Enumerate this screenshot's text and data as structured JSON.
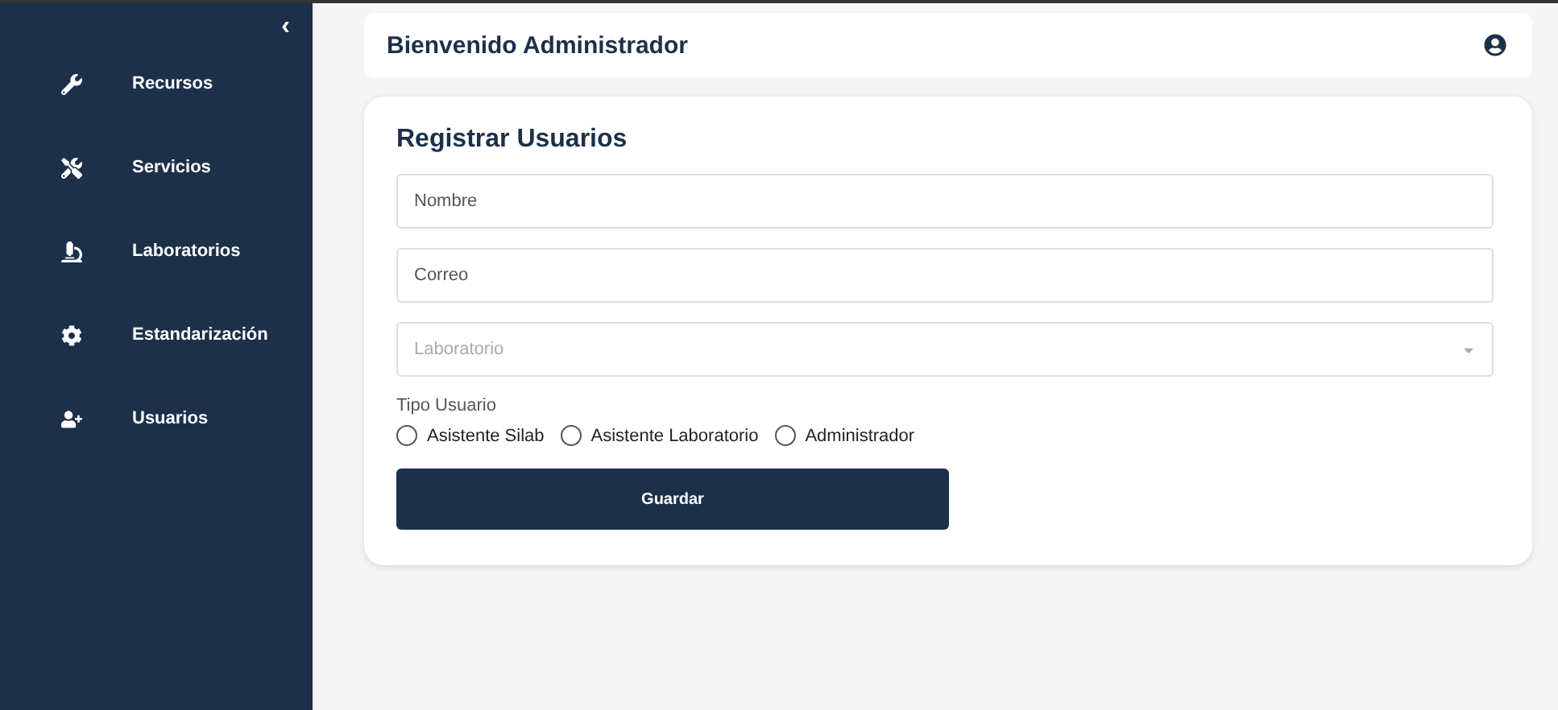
{
  "sidebar": {
    "collapse": "‹",
    "items": [
      {
        "label": "Recursos"
      },
      {
        "label": "Servicios"
      },
      {
        "label": "Laboratorios"
      },
      {
        "label": "Estandarización"
      },
      {
        "label": "Usuarios"
      }
    ]
  },
  "header": {
    "title": "Bienvenido Administrador"
  },
  "form": {
    "title": "Registrar Usuarios",
    "fields": [
      {
        "kind": "text",
        "placeholder": "Nombre"
      },
      {
        "kind": "text",
        "placeholder": "Correo"
      },
      {
        "kind": "select",
        "placeholder": "Laboratorio"
      }
    ],
    "radio_label": "Tipo Usuario",
    "options": [
      {
        "label": "Asistente Silab",
        "selected": false
      },
      {
        "label": "Asistente Laboratorio",
        "selected": false
      },
      {
        "label": "Administrador",
        "selected": false
      }
    ],
    "submit": "Guardar"
  }
}
